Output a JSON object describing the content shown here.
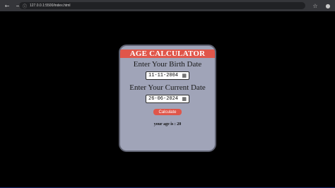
{
  "browser": {
    "url": "127.0.0.1:5500/index.html",
    "back_icon": "arrow-left-icon",
    "forward_icon": "arrow-right-icon",
    "reload_icon": "reload-icon",
    "home_icon": "home-icon",
    "site_info_icon": "site-info-icon",
    "star_icon": "star-icon",
    "profile_icon": "profile-icon"
  },
  "calculator": {
    "title": "AGE CALCULATOR",
    "birth_label": "Enter Your Birth Date",
    "birth_value": "11-11-2004",
    "current_label": "Enter Your Current Date",
    "current_value": "26-06-2024",
    "button_label": "Calculate",
    "result_text": "your age is : 20"
  },
  "colors": {
    "background": "#000000",
    "card": "#a0a4b8",
    "accent": "#e0564a"
  }
}
